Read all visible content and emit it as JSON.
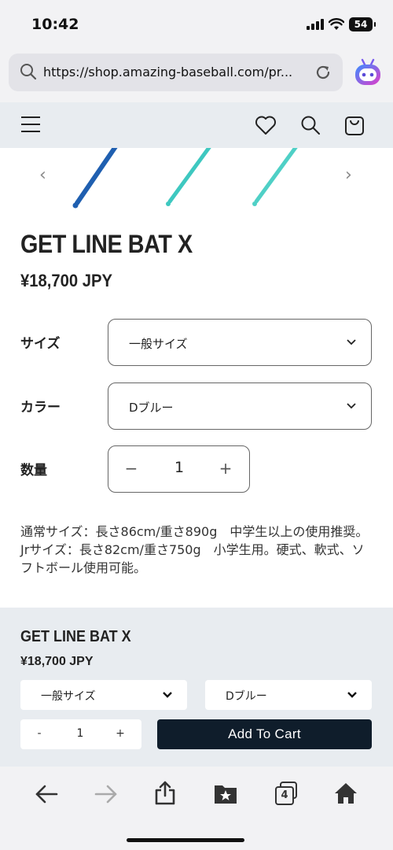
{
  "status": {
    "time": "10:42",
    "battery": "54"
  },
  "browser": {
    "url": "https://shop.amazing-baseball.com/pr..."
  },
  "product": {
    "title": "GET LINE BAT X",
    "price": "¥18,700 JPY",
    "size_label": "サイズ",
    "size_value": "一般サイズ",
    "color_label": "カラー",
    "color_value": "Dブルー",
    "qty_label": "数量",
    "qty_value": "1",
    "minus": "−",
    "plus": "+",
    "description": "通常サイズ：長さ86cm/重さ890g　中学生以上の使用推奨。Jrサイズ：長さ82cm/重さ750g　小学生用。硬式、軟式、ソフトボール使用可能。"
  },
  "sticky": {
    "title": "GET LINE BAT X",
    "price": "¥18,700  JPY",
    "size_value": "一般サイズ",
    "color_value": "Dブルー",
    "qty_value": "1",
    "minus": "-",
    "plus": "+",
    "add_to_cart": "Add To Cart"
  },
  "toolbar": {
    "tabs_count": "4"
  },
  "colors": {
    "bat_dark": "#1f5fb0",
    "bat_light": "#3ec8c0",
    "header_bg": "#e8ecf0",
    "cart_btn": "#0f1d2b"
  },
  "icons": [
    "search-icon",
    "reload-icon",
    "assistant-icon",
    "menu-icon",
    "heart-icon",
    "search-icon",
    "cart-icon",
    "chevron-left-icon",
    "chevron-right-icon",
    "chevron-down-icon",
    "back-icon",
    "forward-icon",
    "share-icon",
    "bookmarks-icon",
    "tabs-icon",
    "home-icon"
  ]
}
